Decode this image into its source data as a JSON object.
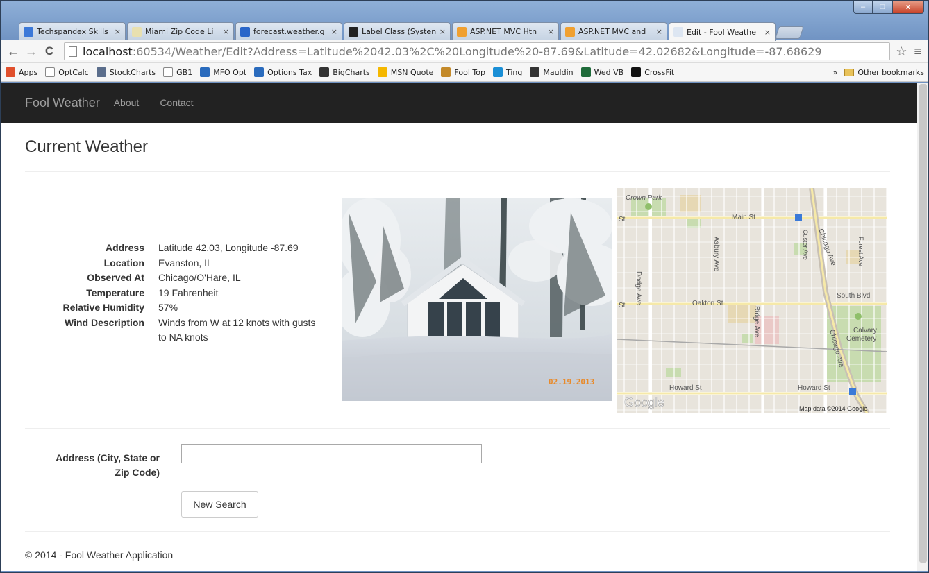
{
  "window": {
    "minimize_label": "–",
    "maximize_label": "□",
    "close_label": "x"
  },
  "tabs": [
    {
      "label": "Techspandex Skills",
      "close": "×",
      "icon_color": "#3b78d8",
      "icon": "doc-icon"
    },
    {
      "label": "Miami Zip Code Li",
      "close": "×",
      "icon_color": "#e8e0b0",
      "icon": "maps-icon"
    },
    {
      "label": "forecast.weather.g",
      "close": "×",
      "icon_color": "#2a66c9",
      "icon": "weather-icon"
    },
    {
      "label": "Label Class (Systen",
      "close": "×",
      "icon_color": "#222222",
      "icon": "msdn-icon"
    },
    {
      "label": "ASP.NET MVC Htn",
      "close": "×",
      "icon_color": "#f0a030",
      "icon": "stackoverflow-icon"
    },
    {
      "label": "ASP.NET MVC and",
      "close": "×",
      "icon_color": "#f0a030",
      "icon": "stackoverflow-icon"
    },
    {
      "label": "Edit - Fool Weathe",
      "close": "×",
      "icon_color": "#dde6f2",
      "icon": "page-icon"
    }
  ],
  "toolbar": {
    "back": "←",
    "forward": "→",
    "reload": "C",
    "url_host": "localhost",
    "url_rest": ":60534/Weather/Edit?Address=Latitude%2042.03%2C%20Longitude%20-87.69&Latitude=42.02682&Longitude=-87.68629",
    "star": "☆",
    "menu": "≡"
  },
  "bookmarks": [
    {
      "label": "Apps",
      "color": "#e04f2c",
      "icon": "apps-icon"
    },
    {
      "label": "OptCalc",
      "color": "#ffffff",
      "icon": "page-icon"
    },
    {
      "label": "StockCharts",
      "color": "#5b6e8c",
      "icon": "chart-icon"
    },
    {
      "label": "GB1",
      "color": "#ffffff",
      "icon": "page-icon"
    },
    {
      "label": "MFO Opt",
      "color": "#2a6bbd",
      "icon": "mfo-icon"
    },
    {
      "label": "Options Tax",
      "color": "#2a6bbd",
      "icon": "mfo-icon"
    },
    {
      "label": "BigCharts",
      "color": "#333333",
      "icon": "bigcharts-icon"
    },
    {
      "label": "MSN Quote",
      "color": "#f5b800",
      "icon": "msn-icon"
    },
    {
      "label": "Fool Top",
      "color": "#c48a2a",
      "icon": "fool-icon"
    },
    {
      "label": "Ting",
      "color": "#1a8fd6",
      "icon": "ting-icon"
    },
    {
      "label": "Mauldin",
      "color": "#333333",
      "icon": "mauldin-icon"
    },
    {
      "label": "Wed VB",
      "color": "#1f6b3a",
      "icon": "vb-icon"
    },
    {
      "label": "CrossFit",
      "color": "#111111",
      "icon": "crossfit-icon"
    }
  ],
  "bookmarks_overflow": "»",
  "other_bookmarks": "Other bookmarks",
  "site": {
    "brand": "Fool Weather",
    "nav": [
      "About",
      "Contact"
    ]
  },
  "page": {
    "title": "Current Weather",
    "details": [
      {
        "label": "Address",
        "value": "Latitude 42.03, Longitude -87.69"
      },
      {
        "label": "Location",
        "value": "Evanston, IL"
      },
      {
        "label": "Observed At",
        "value": "Chicago/O'Hare, IL"
      },
      {
        "label": "Temperature",
        "value": "19 Fahrenheit"
      },
      {
        "label": "Relative Humidity",
        "value": "57%"
      },
      {
        "label": "Wind Description",
        "value": "Winds from W at 12 knots with gusts to NA knots"
      }
    ],
    "photo_date": "02.19.2013",
    "map": {
      "labels": {
        "crown_park": "Crown Park",
        "main_st": "Main St",
        "st_left": "St",
        "oakton_st": "Oakton St",
        "st_left2": "St",
        "south_blvd": "South Blvd",
        "calvary": "Calvary",
        "cemetery": "Cemetery",
        "howard_st": "Howard St",
        "howard_st2": "Howard St",
        "asbury": "Asbury Ave",
        "dodge": "Dodge Ave",
        "ridge": "Ridge Ave",
        "chicago": "Chicago Ave",
        "chicago2": "Chicago Ave",
        "custer": "Custer Ave",
        "forest": "Forest Ave",
        "google": "Google",
        "copyright": "Map data ©2014 Google"
      }
    },
    "form": {
      "label": "Address (City, State or Zip Code)",
      "input_value": "",
      "input_placeholder": "",
      "button": "New Search"
    },
    "footer": "© 2014 - Fool Weather Application"
  }
}
